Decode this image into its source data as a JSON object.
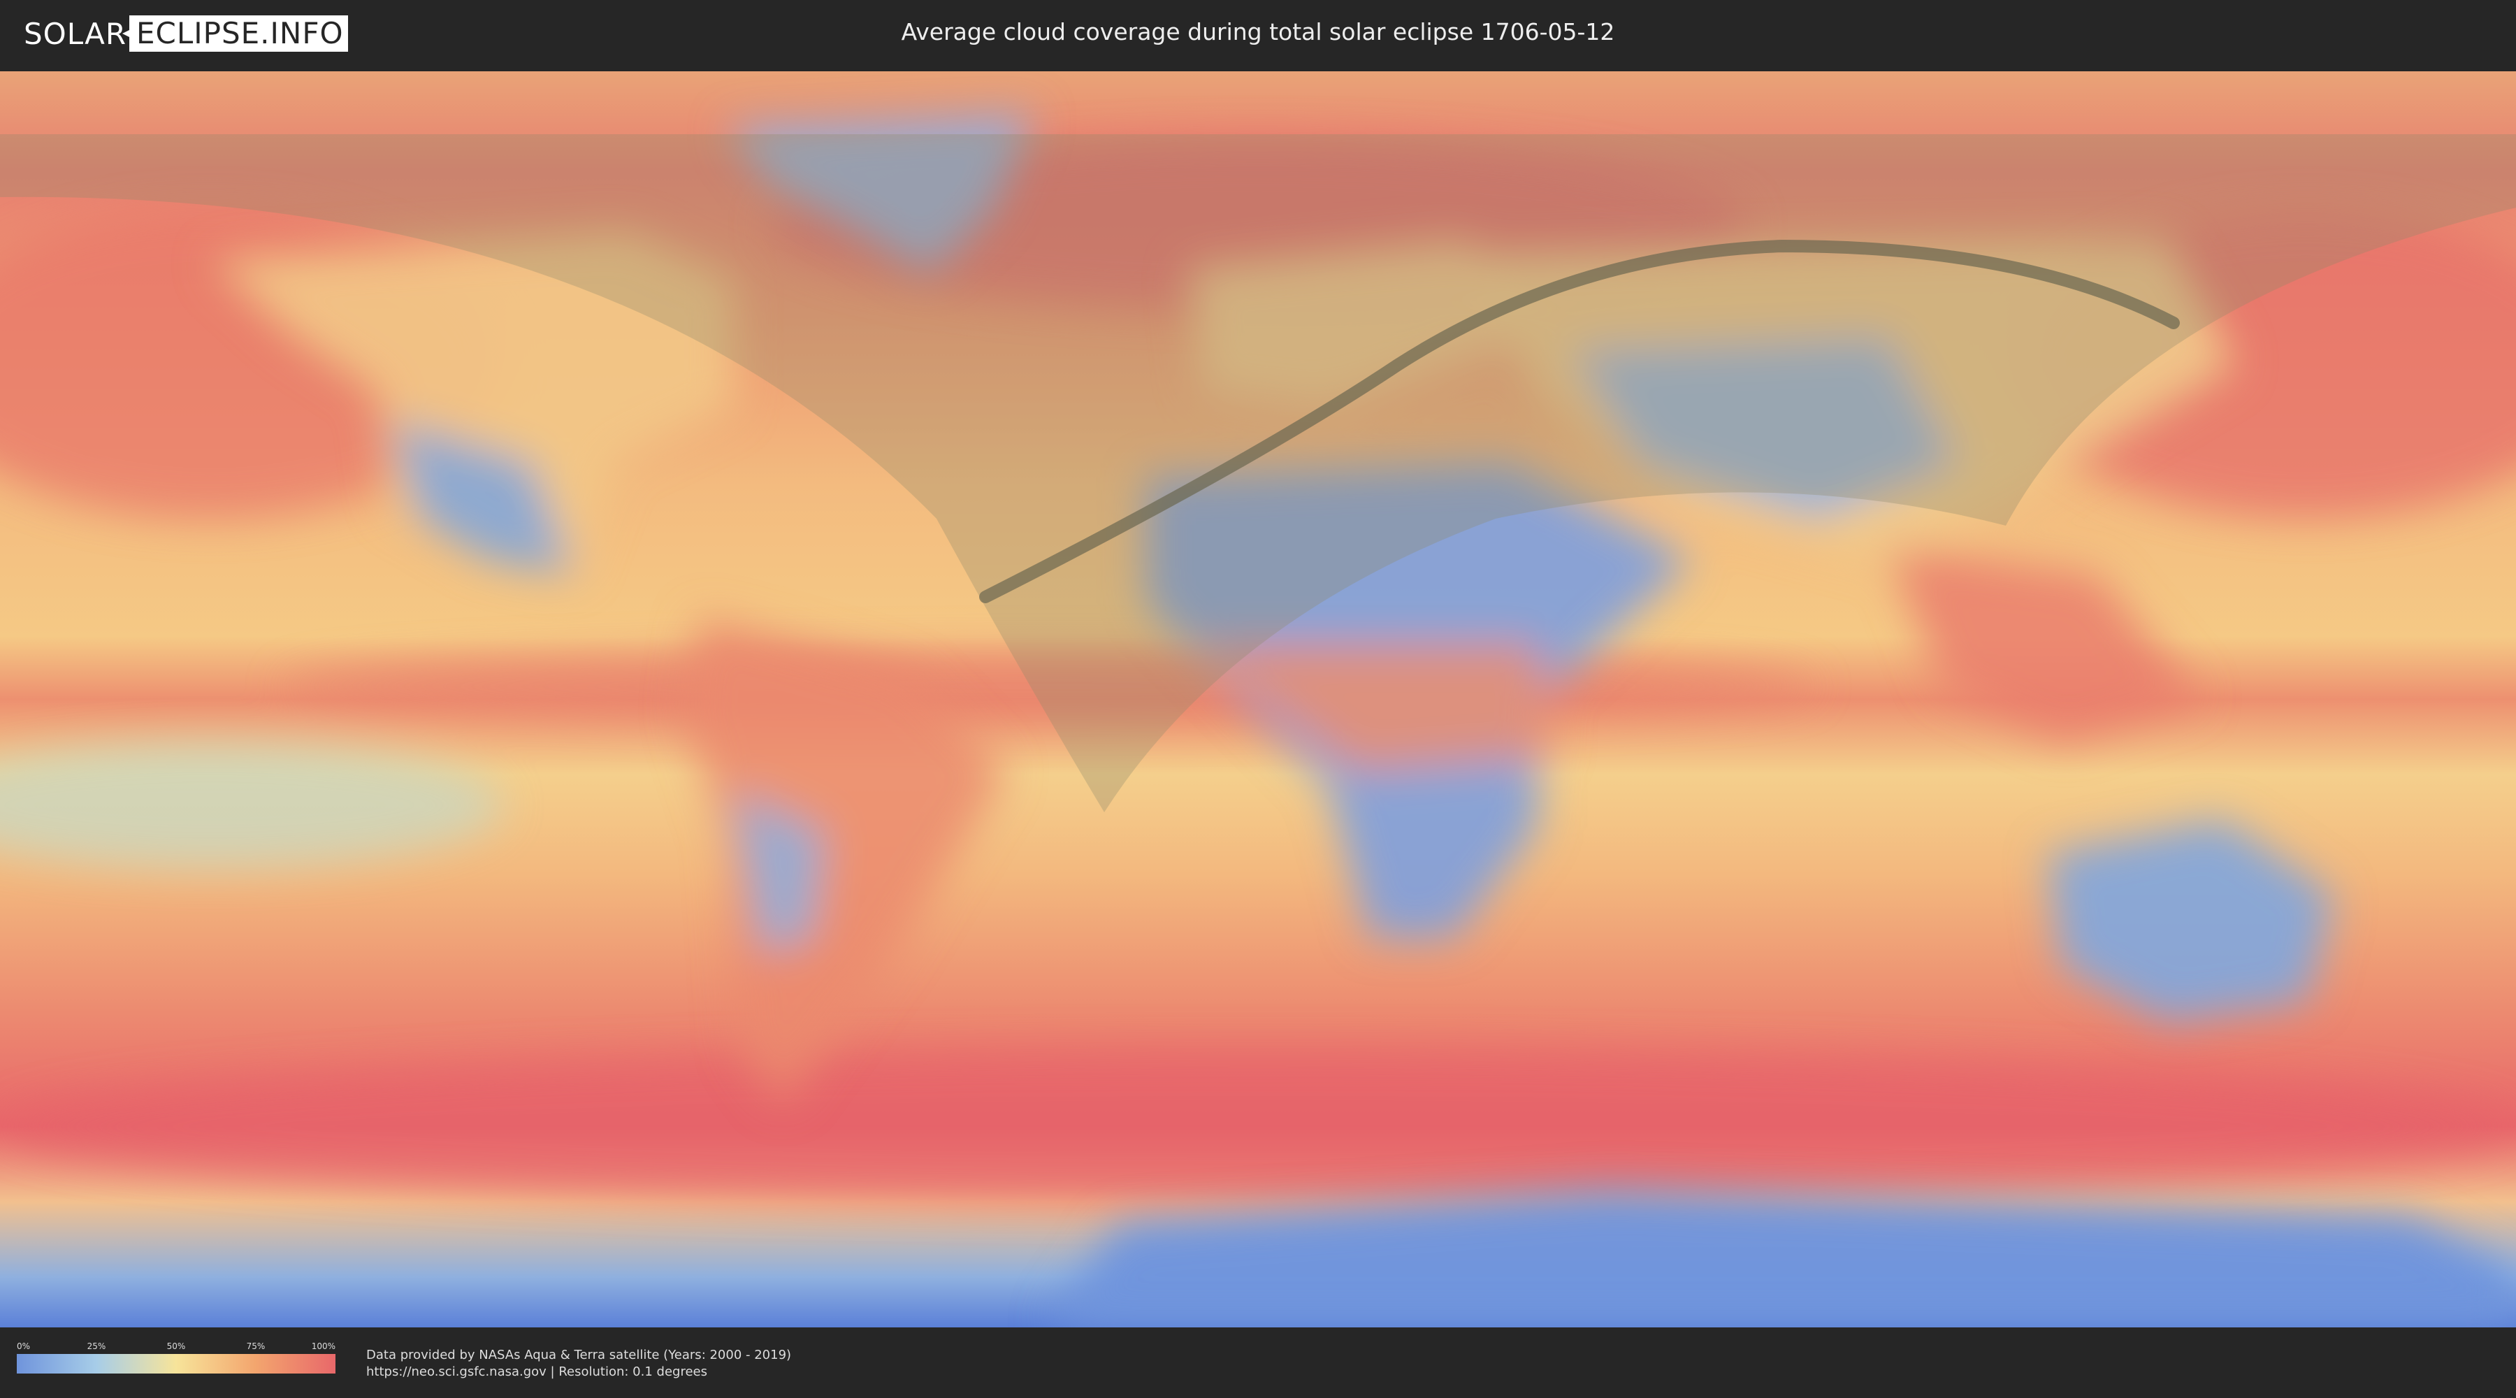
{
  "header": {
    "logo_part1": "SOLAR",
    "logo_part2": "ECLIPSE.INFO",
    "title": "Average cloud coverage during total solar eclipse 1706-05-12"
  },
  "legend": {
    "ticks": [
      "0%",
      "25%",
      "50%",
      "75%",
      "100%"
    ],
    "colors": [
      "#6f94dc",
      "#a7cde8",
      "#f7e49a",
      "#f3a56e",
      "#e8686a"
    ]
  },
  "credits": {
    "line1": "Data provided by NASAs Aqua & Terra satellite (Years: 2000 - 2019)",
    "line2": "https://neo.sci.gsfc.nasa.gov | Resolution: 0.1 degrees"
  },
  "map": {
    "ocean_color": "#f2b47c",
    "cloudy_color": "#e8686a",
    "clear_color": "#7fa2dc"
  }
}
